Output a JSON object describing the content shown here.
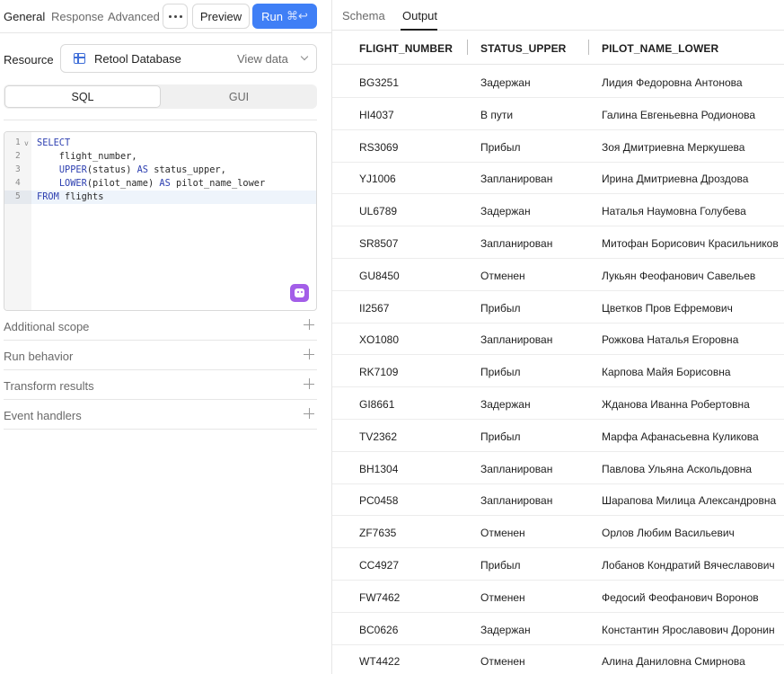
{
  "toolbar": {
    "tabs": [
      "General",
      "Response",
      "Advanced"
    ],
    "more_label": "…",
    "preview_label": "Preview",
    "run_label": "Run",
    "run_shortcut": "⌘↩"
  },
  "resource": {
    "label": "Resource",
    "name": "Retool Database",
    "view_data": "View data"
  },
  "mode": {
    "sql": "SQL",
    "gui": "GUI"
  },
  "editor": {
    "line_numbers": [
      "1",
      "2",
      "3",
      "4",
      "5"
    ],
    "lines": [
      "SELECT",
      "    flight_number,",
      "    UPPER(status) AS status_upper,",
      "    LOWER(pilot_name) AS pilot_name_lower",
      "FROM flights"
    ]
  },
  "sections": [
    "Additional scope",
    "Run behavior",
    "Transform results",
    "Event handlers"
  ],
  "output_tabs": {
    "schema": "Schema",
    "output": "Output"
  },
  "table": {
    "columns": [
      "FLIGHT_NUMBER",
      "STATUS_UPPER",
      "PILOT_NAME_LOWER"
    ],
    "rows": [
      [
        "BG3251",
        "Задержан",
        "Лидия Федоровна Антонова"
      ],
      [
        "HI4037",
        "В пути",
        "Галина Евгеньевна Родионова"
      ],
      [
        "RS3069",
        "Прибыл",
        "Зоя Дмитриевна Меркушева"
      ],
      [
        "YJ1006",
        "Запланирован",
        "Ирина Дмитриевна Дроздова"
      ],
      [
        "UL6789",
        "Задержан",
        "Наталья Наумовна Голубева"
      ],
      [
        "SR8507",
        "Запланирован",
        "Митофан Борисович Красильников"
      ],
      [
        "GU8450",
        "Отменен",
        "Лукьян Феофанович Савельев"
      ],
      [
        "II2567",
        "Прибыл",
        "Цветков Пров Ефремович"
      ],
      [
        "XO1080",
        "Запланирован",
        "Рожкова Наталья Егоровна"
      ],
      [
        "RK7109",
        "Прибыл",
        "Карпова Майя Борисовна"
      ],
      [
        "GI8661",
        "Задержан",
        "Жданова Иванна Робертовна"
      ],
      [
        "TV2362",
        "Прибыл",
        "Марфа Афанасьевна Куликова"
      ],
      [
        "BH1304",
        "Запланирован",
        "Павлова Ульяна Аскольдовна"
      ],
      [
        "PC0458",
        "Запланирован",
        "Шарапова Милица Александровна"
      ],
      [
        "ZF7635",
        "Отменен",
        "Орлов Любим Васильевич"
      ],
      [
        "CC4927",
        "Прибыл",
        "Лобанов Кондратий Вячеславович"
      ],
      [
        "FW7462",
        "Отменен",
        "Федосий Феофанович Воронов"
      ],
      [
        "BC0626",
        "Задержан",
        "Константин Ярославович Доронин"
      ],
      [
        "WT4422",
        "Отменен",
        "Алина Даниловна Смирнова"
      ]
    ]
  },
  "colors": {
    "accent": "#3f7ff6",
    "assist": "#a35ee8",
    "keyword": "#2d3fb0"
  }
}
